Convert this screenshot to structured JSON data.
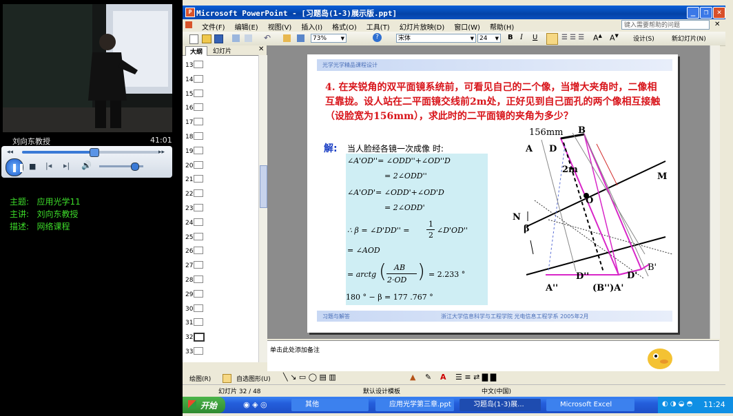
{
  "player": {
    "caption_name": "刘向东教授",
    "time": "41:01",
    "progress": 0.52,
    "volume": 0.8
  },
  "info": {
    "subject_label": "主题:",
    "subject_value": "应用光学11",
    "speaker_label": "主讲:",
    "speaker_value": "刘向东教授",
    "desc_label": "描述:",
    "desc_value": "网络课程"
  },
  "window": {
    "title": "Microsoft PowerPoint - [习题岛(1-3)展示版.ppt]",
    "help_placeholder": "键入需要帮助的问题"
  },
  "menu": [
    "文件(F)",
    "编辑(E)",
    "视图(V)",
    "插入(I)",
    "格式(O)",
    "工具(T)",
    "幻灯片放映(D)",
    "窗口(W)",
    "帮助(H)"
  ],
  "toolbar": {
    "zoom": "73%",
    "font": "宋体",
    "size": "24",
    "bold": "B",
    "italic": "I",
    "underline": "U",
    "design": "设计(S)",
    "new_slide": "新幻灯片(N)"
  },
  "sidepanel": {
    "tab_outline": "大纲",
    "tab_slides": "幻灯片",
    "thumb_numbers": [
      "13",
      "14",
      "15",
      "16",
      "17",
      "18",
      "19",
      "20",
      "21",
      "22",
      "23",
      "24",
      "25",
      "26",
      "27",
      "28",
      "29",
      "30",
      "31",
      "32",
      "33"
    ]
  },
  "slide": {
    "header": "光学光学精品课程设计",
    "question": "4. 在夹锐角的双平面镜系统前，可看见自己的二个像，当增大夹角时，二像相互靠拢。设人站在二平面镜交线前2m处，正好见到自己面孔的两个像相互接触（设脸宽为156mm），求此时的二平面镜的夹角为多少？",
    "solution_label": "解:",
    "solution_intro": "当人脸经各镜一次成像    时:",
    "eq1a": "∠A'OD''= ∠ODD''+∠OD''D",
    "eq1b": "= 2∠ODD''",
    "eq2a": "∠A'OD'= ∠ODD'+∠OD'D",
    "eq2b": "= 2∠ODD'",
    "eq3a": "∴ β = ∠D'DD'' = ",
    "eq3frac_num": "1",
    "eq3frac_den": "2",
    "eq3b": "∠D'OD''",
    "eq4": "= ∠AOD",
    "eq5_prefix": "= arctg",
    "eq5_num": "AB",
    "eq5_den": "2·OD",
    "eq5_suffix": "= 2.233 °",
    "eq6": "180 ° − β = 177 .767 °",
    "fig_156": "156mm",
    "fig_B": "B",
    "fig_A": "A",
    "fig_D": "D",
    "fig_2m": "2m",
    "fig_M": "M",
    "fig_O": "O",
    "fig_N": "N",
    "fig_beta": "β",
    "fig_Dpp": "D''",
    "fig_Dp": "D'",
    "fig_App": "A''",
    "fig_BppAp": "(B'')A'",
    "fig_Bp": "B'",
    "footer_left": "习题与解答",
    "footer_right": "浙江大学信息科学与工程学院  光电信息工程学系  2005年2月"
  },
  "notes": {
    "placeholder": "单击此处添加备注"
  },
  "drawbar": {
    "draw": "绘图(R)",
    "autoshape": "自选图形(U)"
  },
  "status": {
    "slide": "幻灯片 32 / 48",
    "template": "默认设计模板",
    "lang": "中文(中国)"
  },
  "taskbar": {
    "start": "开始",
    "tasks": [
      "其他",
      "应用光学第三章.ppt",
      "习题岛(1-3)展...",
      "Microsoft Excel"
    ],
    "clock": "11:24"
  }
}
